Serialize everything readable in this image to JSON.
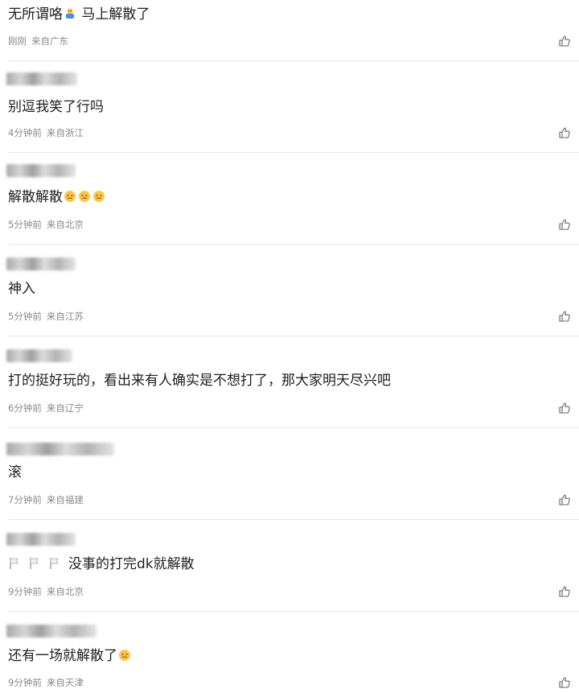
{
  "comments": [
    {
      "content": "无所谓咯",
      "content_after": " 马上解散了",
      "emoji": "person-emoji",
      "time": "刚刚",
      "location": "来自广东"
    },
    {
      "content": "别逗我笑了行吗",
      "time": "4分钟前",
      "location": "来自浙江"
    },
    {
      "content": "解散解散",
      "emoji_count": 3,
      "emoji": "crying-face-emoji",
      "time": "5分钟前",
      "location": "来自北京"
    },
    {
      "content": "神入",
      "time": "5分钟前",
      "location": "来自江苏"
    },
    {
      "content": "打的挺好玩的，看出来有人确实是不想打了，那大家明天尽兴吧",
      "time": "6分钟前",
      "location": "来自辽宁"
    },
    {
      "content": "滚",
      "time": "7分钟前",
      "location": "来自福建"
    },
    {
      "content": "没事的打完dk就解散",
      "flags": 3,
      "emoji": "white-flag-emoji",
      "time": "9分钟前",
      "location": "来自北京"
    },
    {
      "content": "还有一场就解散了",
      "emoji": "crying-face-emoji",
      "time": "9分钟前",
      "location": "来自天津"
    }
  ],
  "icons": {
    "like": "thumbs-up-outline-icon"
  },
  "colors": {
    "text": "#1f1f1f",
    "meta": "#8a8a8a",
    "divider": "#e6e6e6"
  }
}
